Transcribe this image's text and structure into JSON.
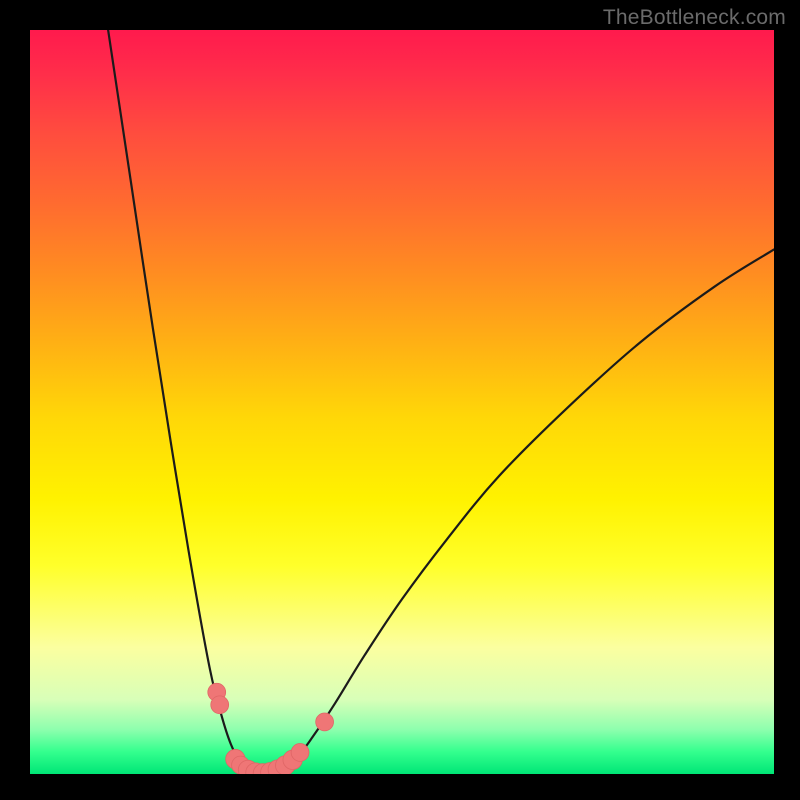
{
  "watermark": "TheBottleneck.com",
  "colors": {
    "background": "#000000",
    "curve": "#1b1b1b",
    "marker_fill": "#ef7676",
    "marker_stroke": "#e06666",
    "watermark_text": "#6b6b6b"
  },
  "chart_data": {
    "type": "line",
    "title": "",
    "xlabel": "",
    "ylabel": "",
    "xlim": [
      0,
      100
    ],
    "ylim": [
      0,
      100
    ],
    "gradient_stops": [
      {
        "pos": 0,
        "color": "#ff1a4d"
      },
      {
        "pos": 23,
        "color": "#ff6a30"
      },
      {
        "pos": 52,
        "color": "#ffd708"
      },
      {
        "pos": 83,
        "color": "#fbffa0"
      },
      {
        "pos": 100,
        "color": "#00e676"
      }
    ],
    "series": [
      {
        "name": "left-branch",
        "points": [
          {
            "x": 10.5,
            "y": 100
          },
          {
            "x": 13.5,
            "y": 80
          },
          {
            "x": 16.5,
            "y": 60
          },
          {
            "x": 19.5,
            "y": 41
          },
          {
            "x": 22.0,
            "y": 26
          },
          {
            "x": 24.2,
            "y": 14
          },
          {
            "x": 25.7,
            "y": 8
          },
          {
            "x": 27.0,
            "y": 4
          },
          {
            "x": 28.5,
            "y": 1.2
          },
          {
            "x": 30.0,
            "y": 0.3
          },
          {
            "x": 31.0,
            "y": 0
          }
        ]
      },
      {
        "name": "right-branch",
        "points": [
          {
            "x": 31.0,
            "y": 0
          },
          {
            "x": 32.5,
            "y": 0.2
          },
          {
            "x": 34.0,
            "y": 0.9
          },
          {
            "x": 36.0,
            "y": 2.4
          },
          {
            "x": 38.0,
            "y": 5
          },
          {
            "x": 41.0,
            "y": 9.5
          },
          {
            "x": 45.0,
            "y": 16
          },
          {
            "x": 50.0,
            "y": 23.5
          },
          {
            "x": 56.0,
            "y": 31.5
          },
          {
            "x": 63.0,
            "y": 40
          },
          {
            "x": 72.0,
            "y": 49
          },
          {
            "x": 82.0,
            "y": 58
          },
          {
            "x": 92.0,
            "y": 65.5
          },
          {
            "x": 100.0,
            "y": 70.5
          }
        ]
      }
    ],
    "markers": [
      {
        "x": 25.1,
        "y": 11,
        "r": 1.2
      },
      {
        "x": 25.5,
        "y": 9.3,
        "r": 1.2
      },
      {
        "x": 27.6,
        "y": 2.0,
        "r": 1.3
      },
      {
        "x": 28.3,
        "y": 1.2,
        "r": 1.2
      },
      {
        "x": 29.3,
        "y": 0.55,
        "r": 1.3
      },
      {
        "x": 30.3,
        "y": 0.2,
        "r": 1.3
      },
      {
        "x": 31.3,
        "y": 0.1,
        "r": 1.3
      },
      {
        "x": 32.3,
        "y": 0.25,
        "r": 1.3
      },
      {
        "x": 33.3,
        "y": 0.6,
        "r": 1.3
      },
      {
        "x": 34.3,
        "y": 1.15,
        "r": 1.3
      },
      {
        "x": 35.3,
        "y": 1.9,
        "r": 1.3
      },
      {
        "x": 36.3,
        "y": 2.9,
        "r": 1.2
      },
      {
        "x": 39.6,
        "y": 7.0,
        "r": 1.2
      }
    ]
  }
}
